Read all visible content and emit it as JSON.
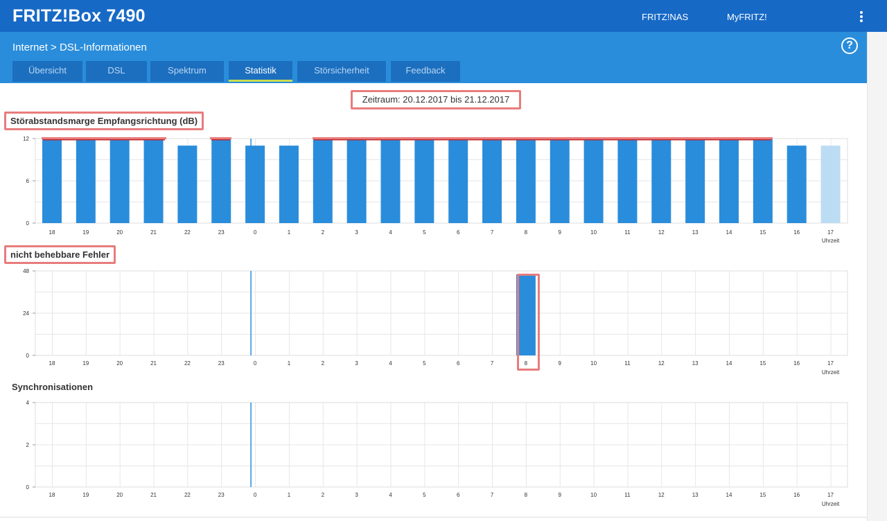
{
  "header": {
    "brand": "FRITZ!Box 7490",
    "links": [
      "FRITZ!NAS",
      "MyFRITZ!"
    ],
    "menu_icon": "kebab-menu-icon"
  },
  "subheader": {
    "breadcrumb": "Internet > DSL-Informationen",
    "help_label": "?",
    "tabs": [
      {
        "label": "Übersicht",
        "active": false
      },
      {
        "label": "DSL",
        "active": false
      },
      {
        "label": "Spektrum",
        "active": false
      },
      {
        "label": "Statistik",
        "active": true
      },
      {
        "label": "Störsicherheit",
        "active": false
      },
      {
        "label": "Feedback",
        "active": false
      }
    ]
  },
  "period": "Zeitraum: 20.12.2017 bis 21.12.2017",
  "colors": {
    "header": "#1769c6",
    "subheader": "#2a8ddb",
    "tab": "#1c6fbf",
    "bar": "#2a8ddb",
    "bar_current": "#bcdcf3",
    "highlight": "#e87c7c",
    "marker": "#c1272d"
  },
  "chart_data": [
    {
      "type": "bar",
      "title": "Störabstandsmarge Empfangsrichtung (dB)",
      "categories": [
        "18",
        "19",
        "20",
        "21",
        "22",
        "23",
        "0",
        "1",
        "2",
        "3",
        "4",
        "5",
        "6",
        "7",
        "8",
        "9",
        "10",
        "11",
        "12",
        "13",
        "14",
        "15",
        "16",
        "17"
      ],
      "x_unit": "Uhrzeit",
      "values": [
        12,
        12,
        12,
        12,
        11,
        12,
        11,
        11,
        12,
        12,
        12,
        12,
        12,
        12,
        12,
        12,
        12,
        12,
        12,
        12,
        12,
        12,
        11,
        11
      ],
      "current_index": 23,
      "ylim": [
        0,
        12
      ],
      "yticks": [
        0,
        6,
        12
      ],
      "grid": true
    },
    {
      "type": "bar",
      "title": "nicht behebbare Fehler",
      "categories": [
        "18",
        "19",
        "20",
        "21",
        "22",
        "23",
        "0",
        "1",
        "2",
        "3",
        "4",
        "5",
        "6",
        "7",
        "8",
        "9",
        "10",
        "11",
        "12",
        "13",
        "14",
        "15",
        "16",
        "17"
      ],
      "x_unit": "Uhrzeit",
      "values": [
        0,
        0,
        0,
        0,
        0,
        0,
        0,
        0,
        0,
        0,
        0,
        0,
        0,
        0,
        46,
        0,
        0,
        0,
        0,
        0,
        0,
        0,
        0,
        0
      ],
      "ylim": [
        0,
        48
      ],
      "yticks": [
        0,
        24,
        48
      ],
      "grid": true
    },
    {
      "type": "bar",
      "title": "Synchronisationen",
      "categories": [
        "18",
        "19",
        "20",
        "21",
        "22",
        "23",
        "0",
        "1",
        "2",
        "3",
        "4",
        "5",
        "6",
        "7",
        "8",
        "9",
        "10",
        "11",
        "12",
        "13",
        "14",
        "15",
        "16",
        "17"
      ],
      "x_unit": "Uhrzeit",
      "values": [
        0,
        0,
        0,
        0,
        0,
        0,
        0,
        0,
        0,
        0,
        0,
        0,
        0,
        0,
        0,
        0,
        0,
        0,
        0,
        0,
        0,
        0,
        0,
        0
      ],
      "ylim": [
        0,
        4
      ],
      "yticks": [
        0,
        2,
        4
      ],
      "grid": true
    }
  ]
}
